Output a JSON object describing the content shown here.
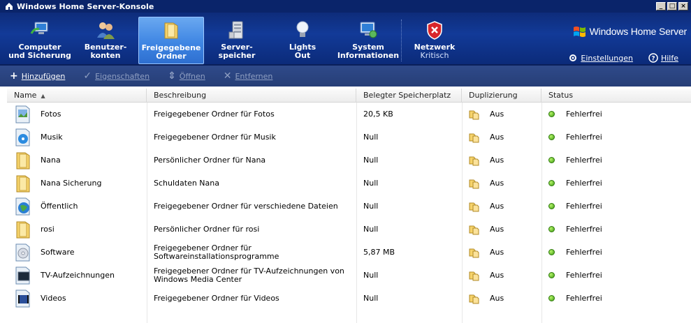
{
  "window": {
    "title": "Windows Home Server-Konsole",
    "min_label": "_",
    "max_label": "□",
    "close_label": "×"
  },
  "nav": {
    "items": [
      {
        "label": "Computer\nund Sicherung",
        "icon": "computer-backup-icon"
      },
      {
        "label": "Benutzer-\nkonten",
        "icon": "users-icon"
      },
      {
        "label": "Freigegebene\nOrdner",
        "icon": "shared-folder-icon",
        "active": true
      },
      {
        "label": "Server-\nspeicher",
        "icon": "server-storage-icon"
      },
      {
        "label": "Lights\nOut",
        "icon": "lightbulb-icon"
      },
      {
        "label": "System\nInformationen",
        "icon": "system-info-icon"
      },
      {
        "label": "Netzwerk",
        "sub": "Kritisch",
        "icon": "network-critical-shield-icon"
      }
    ]
  },
  "brand": {
    "text": "Windows Home Server"
  },
  "header_links": {
    "settings": "Einstellungen",
    "help": "Hilfe"
  },
  "toolbar": {
    "add": "Hinzufügen",
    "properties": "Eigenschaften",
    "open": "Öffnen",
    "remove": "Entfernen"
  },
  "table": {
    "headers": [
      "Name",
      "Beschreibung",
      "Belegter Speicherplatz",
      "Duplizierung",
      "Status"
    ],
    "rows": [
      {
        "name": "Fotos",
        "desc": "Freigegebener Ordner für Fotos",
        "size": "20,5 KB",
        "dup": "Aus",
        "status": "Fehlerfrei",
        "icon": "photos-folder-icon"
      },
      {
        "name": "Musik",
        "desc": "Freigegebener Ordner für Musik",
        "size": "Null",
        "dup": "Aus",
        "status": "Fehlerfrei",
        "icon": "music-folder-icon"
      },
      {
        "name": "Nana",
        "desc": "Persönlicher Ordner für Nana",
        "size": "Null",
        "dup": "Aus",
        "status": "Fehlerfrei",
        "icon": "folder-icon"
      },
      {
        "name": "Nana Sicherung",
        "desc": "Schuldaten Nana",
        "size": "Null",
        "dup": "Aus",
        "status": "Fehlerfrei",
        "icon": "folder-icon"
      },
      {
        "name": "Öffentlich",
        "desc": "Freigegebener Ordner für verschiedene Dateien",
        "size": "Null",
        "dup": "Aus",
        "status": "Fehlerfrei",
        "icon": "public-folder-icon"
      },
      {
        "name": "rosi",
        "desc": "Persönlicher Ordner für rosi",
        "size": "Null",
        "dup": "Aus",
        "status": "Fehlerfrei",
        "icon": "folder-icon"
      },
      {
        "name": "Software",
        "desc": "Freigegebener Ordner für Softwareinstallationsprogramme",
        "size": "5,87 MB",
        "dup": "Aus",
        "status": "Fehlerfrei",
        "icon": "software-folder-icon"
      },
      {
        "name": "TV-Aufzeichnungen",
        "desc": "Freigegebener Ordner für TV-Aufzeichnungen von Windows Media Center",
        "size": "Null",
        "dup": "Aus",
        "status": "Fehlerfrei",
        "icon": "tv-folder-icon"
      },
      {
        "name": "Videos",
        "desc": "Freigegebener Ordner für Videos",
        "size": "Null",
        "dup": "Aus",
        "status": "Fehlerfrei",
        "icon": "videos-folder-icon"
      }
    ]
  }
}
